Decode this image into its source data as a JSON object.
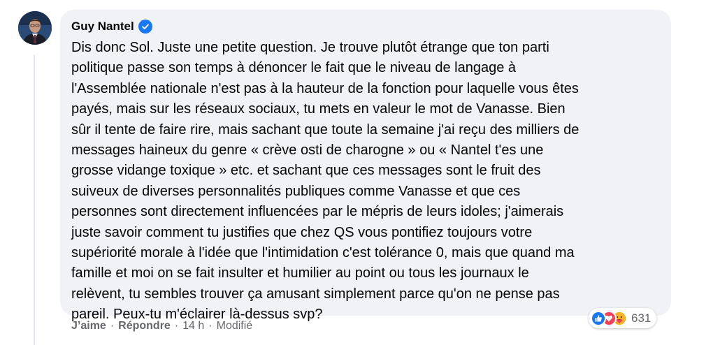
{
  "comment": {
    "author": "Guy Nantel",
    "verified": true,
    "text_lines": [
      "Dis donc Sol. Juste une petite question. Je trouve plutôt étrange que ton parti",
      "politique passe son temps à dénoncer le fait que le niveau de langage à",
      "l'Assemblée nationale n'est pas à la hauteur de la fonction pour laquelle vous êtes",
      "payés, mais sur les réseaux sociaux, tu mets en valeur le mot de Vanasse. Bien",
      "sûr il tente de faire rire, mais sachant que toute la semaine j'ai reçu des milliers de",
      "messages haineux du genre « crève osti de charogne » ou « Nantel t'es une",
      "grosse vidange toxique » etc. et sachant que ces messages sont le fruit des",
      "suiveux de diverses personnalités publiques comme Vanasse et que ces",
      "personnes sont directement influencées par le mépris de leurs idoles; j'aimerais",
      "juste savoir comment tu justifies que chez QS vous pontifiez toujours votre",
      "supériorité morale à l'idée que l'intimidation c'est tolérance 0, mais que quand ma",
      "famille et moi on se fait insulter et humilier au point ou tous les journaux le",
      "relèvent, tu sembles trouver ça amusant simplement parce qu'on ne pense pas",
      "pareil. Peux-tu m'éclairer là-dessus svp?"
    ]
  },
  "reactions": {
    "icons": [
      "like-icon",
      "love-icon",
      "care-icon"
    ],
    "count": "631"
  },
  "actions": {
    "like": "J’aime",
    "reply": "Répondre",
    "time": "14 h",
    "edited": "Modifié",
    "separator": "·"
  },
  "colors": {
    "bubble": "#f0f2f5",
    "text": "#050505",
    "meta": "#65676b",
    "like_blue": "#1877f2",
    "love_red": "#f33e58",
    "care_yellow": "#f7b125"
  }
}
